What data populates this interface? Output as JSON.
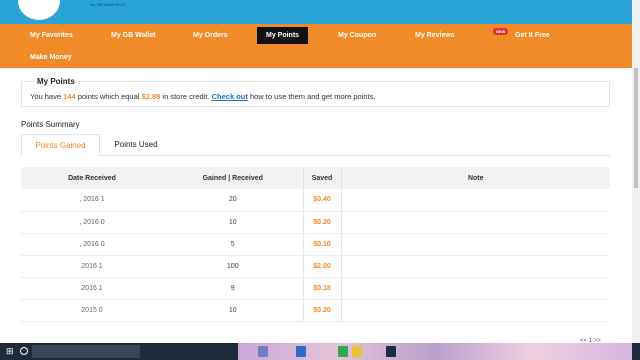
{
  "header": {
    "tiny_text": "My GB Wallet  $0.00"
  },
  "nav": {
    "items": [
      "My Favorites",
      "My GB Wallet",
      "My Orders",
      "My Points",
      "My Coupon",
      "My Reviews",
      "Get It Free",
      "Make Money"
    ],
    "active": "My Points",
    "badge": "NEW"
  },
  "points": {
    "legend": "My Points",
    "line_prefix": "You have",
    "count": "144",
    "line_mid": "points which equal",
    "credit": "$2.88",
    "line_mid2": "in store credit.",
    "link": "Check out",
    "line_suffix": "how to use them and get more points."
  },
  "summary": {
    "title": "Points Summary",
    "tabs": [
      "Points Gained",
      "Points Used"
    ],
    "columns": [
      "Date Received",
      "Gained | Received",
      "Saved",
      "Note"
    ],
    "rows": [
      {
        "date": ", 2016 1",
        "gained": "20",
        "saved": "$0.40",
        "note": ""
      },
      {
        "date": ", 2016 0",
        "gained": "10",
        "saved": "$0.20",
        "note": ""
      },
      {
        "date": ", 2016 0",
        "gained": "5",
        "saved": "$0.10",
        "note": ""
      },
      {
        "date": "2016 1",
        "gained": "100",
        "saved": "$2.00",
        "note": ""
      },
      {
        "date": "2016 1",
        "gained": "9",
        "saved": "$0.18",
        "note": ""
      },
      {
        "date": "2015 0",
        "gained": "10",
        "saved": "$0.20",
        "note": ""
      }
    ]
  },
  "pager": {
    "prev": "<<",
    "page": "1",
    "next": ">>"
  },
  "taskbar": {
    "search_placeholder": ""
  }
}
